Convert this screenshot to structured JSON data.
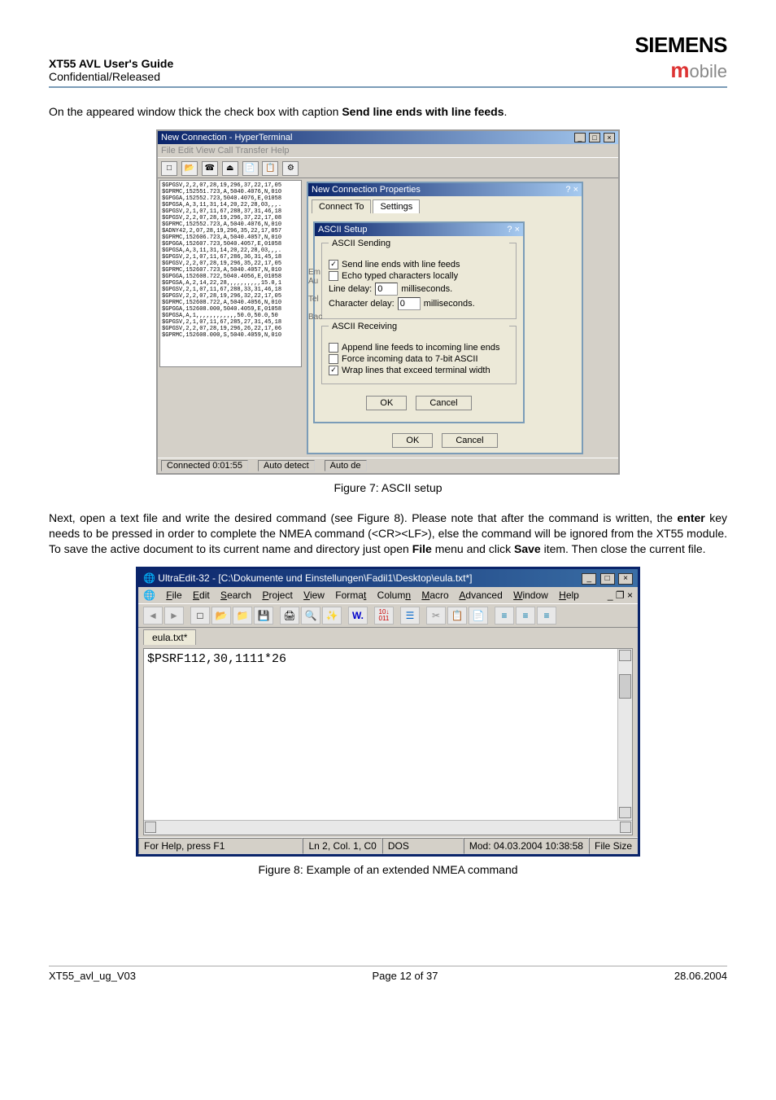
{
  "header": {
    "title": "XT55 AVL User's Guide",
    "subtitle": "Confidential/Released",
    "brand_line1": "SIEMENS",
    "brand_m": "m",
    "brand_rest": "obile"
  },
  "intro_para_parts": {
    "p1_a": "On the appeared window thick the check box with caption ",
    "p1_b": "Send line ends with line feeds",
    "p1_c": "."
  },
  "fig7_caption": "Figure 7: ASCII setup",
  "para2_plain": "Next, open a text file and write the desired command (see Figure 8). Please note that after the command is written, the ",
  "para2_enter": "enter",
  "para2_mid": " key needs to be pressed in order to complete the NMEA command (<CR><LF>), else the command will be ignored from the XT55 module. To save the active document to its current name and directory just open ",
  "para2_file": "File",
  "para2_mid2": " menu and click ",
  "para2_save": "Save",
  "para2_end": " item. Then close the current file.",
  "fig8_caption": "Figure 8: Example of an extended NMEA command",
  "hyperterm": {
    "title": "New Connection - HyperTerminal",
    "menubar": "File  Edit  View  Call  Transfer  Help",
    "text_lines": [
      "$GPGSV,2,2,07,28,19,296,37,22,17,05",
      "$GPRMC,152551.723,A,5040.4076,N,010",
      "$GPGGA,152552.723,5040.4076,E,01058",
      "$GPGSA,A,3,11,31,14,20,22,28,03,,,.",
      "$GPGSV,2,1,07,11,67,288,37,31,46,18",
      "$GPGSV,2,2,07,28,19,296,37,22,17,08",
      "$GPRMC,152552.723,A,5040.4076,N,010",
      "$ADNY42,2,07,28,19,296,35,22,17,057",
      "$GPRMC,152606.723,A,5040.4057,N,010",
      "$GPGGA,152607.723,5040.4057,E,01058",
      "$GPGSA,A,3,11,31,14,20,22,28,03,,,.",
      "$GPGSV,2,1,07,11,67,286,36,31,45,18",
      "$GPGSV,2,2,07,28,19,296,35,22,17,05",
      "$GPRMC,152607.723,A,5040.4057,N,010",
      "$GPGGA,152608.722,5040.4056,E,01058",
      "$GPGSA,A,2,14,22,28,,,,,,,,,,15.0,1",
      "$GPGSV,2,1,07,11,67,288,33,31,46,18",
      "$GPGSV,2,2,07,28,19,296,32,22,17,05",
      "$GPRMC,152608.722,A,5040.4056,N,010",
      "$GPGGA,152608.000,5040.4059,E,01058",
      "$GPGSA,A,1,,,,,,,,,,,,50.0,50.0,50",
      "$GPGSV,2,1,07,11,67,285,27,31,45,18",
      "$GPGSV,2,2,07,28,19,296,26,22,17,06",
      "$GPRMC,152608.000,S,5040.4059,N,010"
    ],
    "prop_title": "New Connection Properties",
    "prop_tabs": [
      "Connect To",
      "Settings"
    ],
    "em": "Em",
    "au": "Au",
    "tel": "Tel",
    "bac": "Bac",
    "status": {
      "connected": "Connected 0:01:55",
      "detect": "Auto detect",
      "mode": "Auto de"
    },
    "btn_ok": "OK",
    "btn_cancel": "Cancel"
  },
  "ascii_dialog": {
    "title": "ASCII Setup",
    "sending_legend": "ASCII Sending",
    "cb_send_line_ends": "Send line ends with line feeds",
    "cb_echo": "Echo typed characters locally",
    "line_delay_label": "Line delay:",
    "line_delay_value": "0",
    "ms": "milliseconds.",
    "char_delay_label": "Character delay:",
    "char_delay_value": "0",
    "ms2": "milliseconds.",
    "receiving_legend": "ASCII Receiving",
    "cb_append": "Append line feeds to incoming line ends",
    "cb_force7": "Force incoming data to 7-bit ASCII",
    "cb_wrap": "Wrap lines that exceed terminal width",
    "ok": "OK",
    "cancel": "Cancel"
  },
  "ultraedit": {
    "title": "UltraEdit-32 - [C:\\Dokumente und Einstellungen\\Fadil1\\Desktop\\eula.txt*]",
    "globe": "🌐",
    "menus": {
      "file": "File",
      "edit": "Edit",
      "search": "Search",
      "project": "Project",
      "view": "View",
      "format": "Format",
      "column": "Column",
      "macro": "Macro",
      "advanced": "Advanced",
      "window": "Window",
      "help": "Help"
    },
    "toolbar_icons": {
      "back": "◄",
      "fwd": "►",
      "new": "□",
      "open": "📂",
      "open2": "📁",
      "save": "💾",
      "print": "🖨",
      "preview": "🔍",
      "tools": "✨",
      "word": "W.",
      "hex": "10↓\n011",
      "list": "☰",
      "cut": "✂",
      "copy": "📋",
      "paste": "📄",
      "left": "≡",
      "center": "≡",
      "right": "≡"
    },
    "tab": "eula.txt*",
    "editor_text": "$PSRF112,30,1111*26",
    "status": {
      "help": "For Help, press F1",
      "pos": "Ln 2, Col. 1, C0",
      "dos": "DOS",
      "mod": "Mod: 04.03.2004 10:38:58",
      "fsize": "File Size"
    }
  },
  "footer": {
    "left": "XT55_avl_ug_V03",
    "center": "Page 12 of 37",
    "right": "28.06.2004"
  },
  "icons": {
    "qmark": "?",
    "x": "×",
    "min": "_",
    "max": "□"
  }
}
